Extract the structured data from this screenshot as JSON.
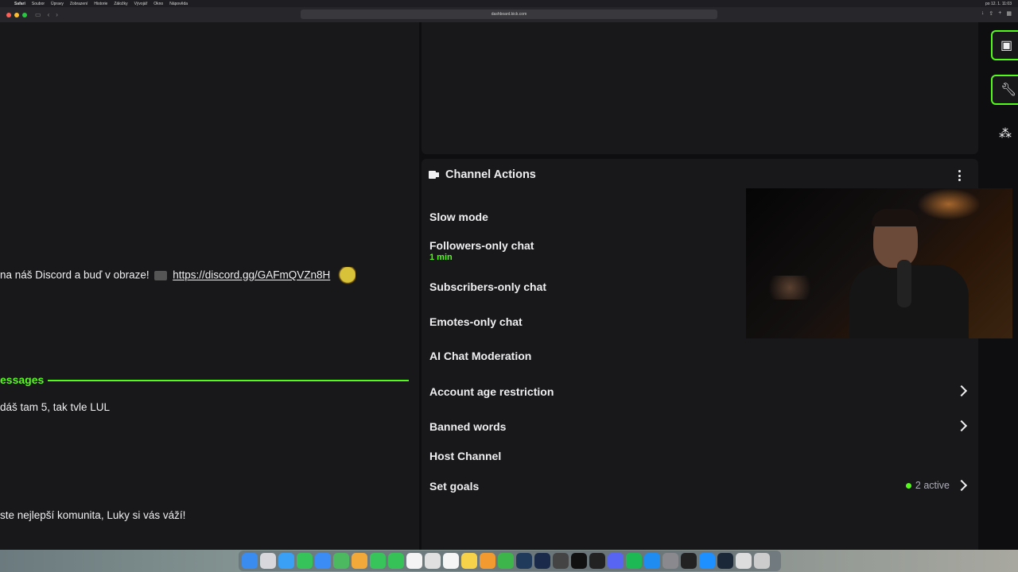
{
  "menubar": {
    "items": [
      "Safari",
      "Soubor",
      "Úpravy",
      "Zobrazení",
      "Historie",
      "Záložky",
      "Vývojář",
      "Okno",
      "Nápověda"
    ],
    "clock": "po 12. 1. 11:03"
  },
  "browser": {
    "url": "dashboard.kick.com"
  },
  "chat": {
    "msg_discord_prefix": "na náš Discord a buď v obraze!",
    "msg_discord_link": "https://discord.gg/GAFmQVZn8H",
    "new_messages_label": "essages",
    "msg_2": "dáš tam 5, tak tvle LUL",
    "msg_3": "ste nejlepší komunita, Luky si vás váží!"
  },
  "channel_actions": {
    "title": "Channel Actions",
    "rows": {
      "slow_mode": "Slow mode",
      "followers_only": "Followers-only chat",
      "followers_only_value": "1 min",
      "subscribers_only": "Subscribers-only chat",
      "emotes_only": "Emotes-only chat",
      "ai_moderation": "AI Chat Moderation",
      "account_age": "Account age restriction",
      "banned_words": "Banned words",
      "host_channel": "Host Channel",
      "set_goals": "Set goals",
      "set_goals_status": "2 active"
    }
  },
  "colors": {
    "accent": "#53fc18",
    "panel": "#18181b",
    "background": "#0e0e10",
    "text": "#efeff1"
  },
  "icons": {
    "sidebar": [
      "channel-actions-icon",
      "wrench-icon",
      "cluster-icon"
    ],
    "header": "channel-actions-icon",
    "menu": "kebab-menu-icon",
    "row_arrow": "chevron-right-icon"
  }
}
